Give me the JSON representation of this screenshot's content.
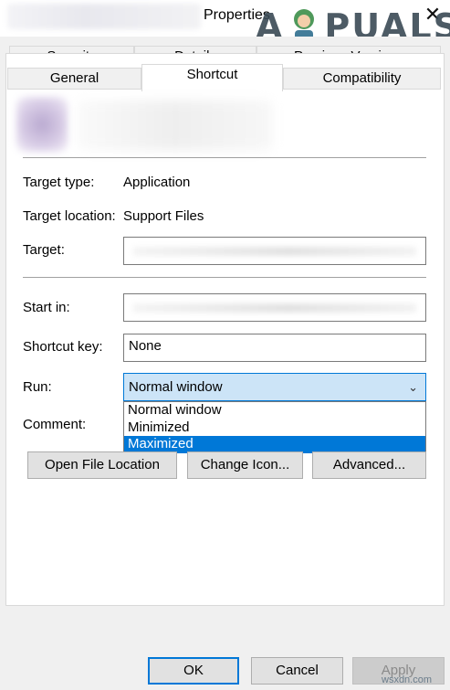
{
  "window": {
    "title": "Properties"
  },
  "tabs_row1": [
    "Security",
    "Details",
    "Previous Versions"
  ],
  "tabs_row2": [
    "General",
    "Shortcut",
    "Compatibility"
  ],
  "fields": {
    "target_type_label": "Target type:",
    "target_type_value": "Application",
    "target_location_label": "Target location:",
    "target_location_value": "Support Files",
    "target_label": "Target:",
    "start_in_label": "Start in:",
    "shortcut_key_label": "Shortcut key:",
    "shortcut_key_value": "None",
    "run_label": "Run:",
    "run_value": "Normal window",
    "comment_label": "Comment:"
  },
  "run_options": [
    "Normal window",
    "Minimized",
    "Maximized"
  ],
  "run_highlighted": "Maximized",
  "buttons": {
    "open_file_location": "Open File Location",
    "change_icon": "Change Icon...",
    "advanced": "Advanced...",
    "ok": "OK",
    "cancel": "Cancel",
    "apply": "Apply"
  },
  "logo": {
    "left": "A",
    "right": "PUALS"
  },
  "watermark": "wsxdn.com",
  "colors": {
    "selection": "#0078d7",
    "select_bg": "#cce4f7"
  }
}
